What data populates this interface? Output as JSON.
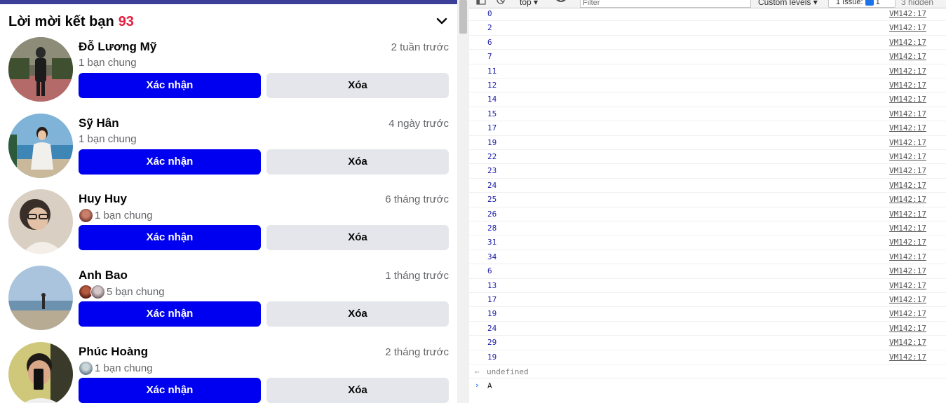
{
  "friend_requests": {
    "title": "Lời mời kết bạn",
    "count": "93",
    "items": [
      {
        "name": "Đỗ Lương Mỹ",
        "time": "2 tuần trước",
        "mutual": "1 bạn chung",
        "confirm": "Xác nhận",
        "delete": "Xóa"
      },
      {
        "name": "Sỹ Hân",
        "time": "4 ngày trước",
        "mutual": "1 bạn chung",
        "confirm": "Xác nhận",
        "delete": "Xóa"
      },
      {
        "name": "Huy Huy",
        "time": "6 tháng trước",
        "mutual": "1 bạn chung",
        "confirm": "Xác nhận",
        "delete": "Xóa"
      },
      {
        "name": "Anh Bao",
        "time": "1 tháng trước",
        "mutual": "5 bạn chung",
        "confirm": "Xác nhận",
        "delete": "Xóa"
      },
      {
        "name": "Phúc Hoàng",
        "time": "2 tháng trước",
        "mutual": "1 bạn chung",
        "confirm": "Xác nhận",
        "delete": "Xóa"
      }
    ]
  },
  "console": {
    "toolbar": {
      "context": "top",
      "filter_placeholder": "Filter",
      "levels": "Custom levels",
      "issues": "1 Issue:",
      "issues_count": "1",
      "hidden": "3 hidden"
    },
    "logs": [
      {
        "value": "0",
        "source": "VM142:17"
      },
      {
        "value": "2",
        "source": "VM142:17"
      },
      {
        "value": "6",
        "source": "VM142:17"
      },
      {
        "value": "7",
        "source": "VM142:17"
      },
      {
        "value": "11",
        "source": "VM142:17"
      },
      {
        "value": "12",
        "source": "VM142:17"
      },
      {
        "value": "14",
        "source": "VM142:17"
      },
      {
        "value": "15",
        "source": "VM142:17"
      },
      {
        "value": "17",
        "source": "VM142:17"
      },
      {
        "value": "19",
        "source": "VM142:17"
      },
      {
        "value": "22",
        "source": "VM142:17"
      },
      {
        "value": "23",
        "source": "VM142:17"
      },
      {
        "value": "24",
        "source": "VM142:17"
      },
      {
        "value": "25",
        "source": "VM142:17"
      },
      {
        "value": "26",
        "source": "VM142:17"
      },
      {
        "value": "28",
        "source": "VM142:17"
      },
      {
        "value": "31",
        "source": "VM142:17"
      },
      {
        "value": "34",
        "source": "VM142:17"
      },
      {
        "value": "6",
        "source": "VM142:17"
      },
      {
        "value": "13",
        "source": "VM142:17"
      },
      {
        "value": "17",
        "source": "VM142:17"
      },
      {
        "value": "19",
        "source": "VM142:17"
      },
      {
        "value": "24",
        "source": "VM142:17"
      },
      {
        "value": "29",
        "source": "VM142:17"
      },
      {
        "value": "19",
        "source": "VM142:17"
      }
    ],
    "return_value": "undefined",
    "input": "A"
  },
  "colors": {
    "confirm_button": "#0000f0",
    "count_badge": "#e41e3f",
    "delete_button": "#e4e6eb",
    "log_number": "#1a1aa6"
  }
}
